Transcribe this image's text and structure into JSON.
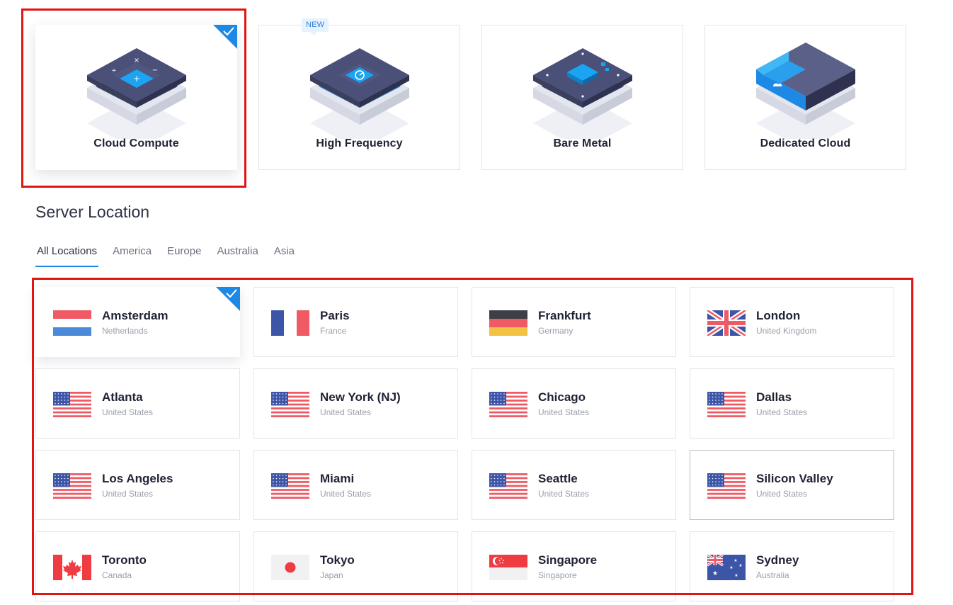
{
  "server_types": [
    {
      "label": "Cloud Compute",
      "selected": true,
      "icon": "cloud-compute-server-icon"
    },
    {
      "label": "High Frequency",
      "badge": "NEW",
      "icon": "high-frequency-server-icon"
    },
    {
      "label": "Bare Metal",
      "icon": "bare-metal-server-icon"
    },
    {
      "label": "Dedicated Cloud",
      "icon": "dedicated-cloud-server-icon"
    }
  ],
  "server_location": {
    "title": "Server Location",
    "tabs": [
      "All Locations",
      "America",
      "Europe",
      "Australia",
      "Asia"
    ],
    "active_tab": "All Locations",
    "locations": [
      {
        "city": "Amsterdam",
        "country": "Netherlands",
        "flag": "netherlands-flag",
        "selected": true
      },
      {
        "city": "Paris",
        "country": "France",
        "flag": "france-flag"
      },
      {
        "city": "Frankfurt",
        "country": "Germany",
        "flag": "germany-flag"
      },
      {
        "city": "London",
        "country": "United Kingdom",
        "flag": "uk-flag"
      },
      {
        "city": "Atlanta",
        "country": "United States",
        "flag": "us-flag"
      },
      {
        "city": "New York (NJ)",
        "country": "United States",
        "flag": "us-flag"
      },
      {
        "city": "Chicago",
        "country": "United States",
        "flag": "us-flag"
      },
      {
        "city": "Dallas",
        "country": "United States",
        "flag": "us-flag"
      },
      {
        "city": "Los Angeles",
        "country": "United States",
        "flag": "us-flag"
      },
      {
        "city": "Miami",
        "country": "United States",
        "flag": "us-flag"
      },
      {
        "city": "Seattle",
        "country": "United States",
        "flag": "us-flag"
      },
      {
        "city": "Silicon Valley",
        "country": "United States",
        "flag": "us-flag"
      },
      {
        "city": "Toronto",
        "country": "Canada",
        "flag": "canada-flag"
      },
      {
        "city": "Tokyo",
        "country": "Japan",
        "flag": "japan-flag"
      },
      {
        "city": "Singapore",
        "country": "Singapore",
        "flag": "singapore-flag"
      },
      {
        "city": "Sydney",
        "country": "Australia",
        "flag": "australia-flag"
      }
    ]
  },
  "colors": {
    "accent": "#1e88e5",
    "annotation": "#e11414",
    "server_navy": "#3d4266",
    "server_blue": "#1aa4f2"
  }
}
